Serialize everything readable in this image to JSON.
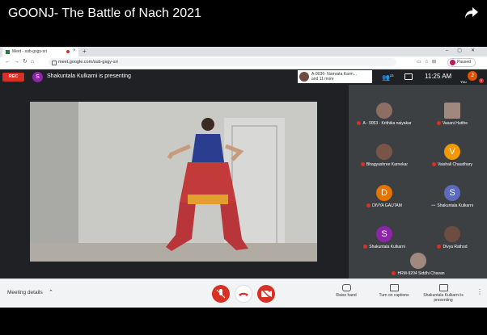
{
  "video_title": "GOONJ- The Battle of Nach 2021",
  "browser": {
    "tab_title": "Meet - sub-gsgy-sri",
    "url": "meet.google.com/sub-gsgy-sri",
    "profile_status": "Paused"
  },
  "meet": {
    "rec_label": "REC",
    "presenter_initial": "S",
    "presenter_status": "Shakuntala Kulkarni is presenting",
    "notification": {
      "name": "A-9036- Namrata Karm...",
      "more": "and 11 more"
    },
    "people_count": "23",
    "time": "11:25 AM",
    "you_label": "You",
    "you_initial": "J",
    "you_badge": "5"
  },
  "participants": [
    {
      "name": "A - 9053 - Krithika naiyakar",
      "type": "photo"
    },
    {
      "name": "Vasani Hutthe",
      "type": "photo"
    },
    {
      "name": "Bhagyashree Karnekar",
      "type": "photo"
    },
    {
      "name": "Vaishali Chaudhary",
      "type": "avatar",
      "initial": "V",
      "color": "#f29900"
    },
    {
      "name": "DIVYA GAUTAM",
      "type": "avatar",
      "initial": "D",
      "color": "#e37400"
    },
    {
      "name": "Shakuntala Kulkarni",
      "type": "avatar",
      "initial": "S",
      "color": "#5c6bc0"
    },
    {
      "name": "Shakuntala Kulkarni",
      "type": "avatar",
      "initial": "S",
      "color": "#8e24aa"
    },
    {
      "name": "Divya Rathod",
      "type": "photo"
    },
    {
      "name": "HRM-9204 Siddhi Chavan",
      "type": "photo"
    }
  ],
  "bottom": {
    "meeting_details": "Meeting details",
    "raise_hand": "Raise hand",
    "captions": "Turn on captions",
    "presenting": "Shakuntala Kulkarni is presenting"
  }
}
